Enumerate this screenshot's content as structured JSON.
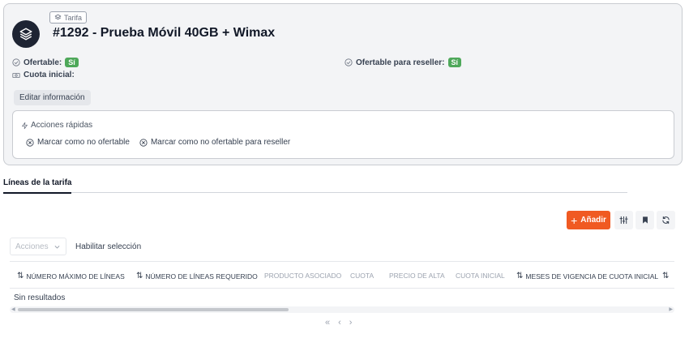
{
  "header": {
    "type_badge": "Tarifa",
    "type_icon": "layers-icon",
    "title": "#1292 - Prueba Móvil 40GB + Wimax"
  },
  "fields": {
    "ofertable_label": "Ofertable:",
    "ofertable_value": "Sí",
    "reseller_label": "Ofertable para reseller:",
    "reseller_value": "Sí",
    "cuota_label": "Cuota inicial:"
  },
  "edit_button": "Editar información",
  "quick_actions": {
    "title": "Acciones rápidas",
    "items": [
      "Marcar como no ofertable",
      "Marcar como no ofertable para reseller"
    ]
  },
  "tabs": [
    {
      "label": "Líneas de la tarifa",
      "active": true
    }
  ],
  "toolbar": {
    "add_label": "Añadir",
    "icons": [
      "columns-adjust-icon",
      "bookmark-icon",
      "refresh-icon"
    ]
  },
  "table_controls": {
    "actions_placeholder": "Acciones",
    "enable_selection": "Habilitar selección"
  },
  "table": {
    "columns": [
      {
        "label": "Número máximo de líneas",
        "sortable": true
      },
      {
        "label": "Número de líneas requerido",
        "sortable": true
      },
      {
        "label": "Producto asociado",
        "sortable": false
      },
      {
        "label": "Cuota",
        "sortable": false
      },
      {
        "label": "Precio de alta",
        "sortable": false
      },
      {
        "label": "Cuota inicial",
        "sortable": false
      },
      {
        "label": "Meses de vigencia de cuota inicial",
        "sortable": true
      },
      {
        "label": "",
        "sortable": true
      }
    ],
    "empty_text": "Sin resultados"
  },
  "colors": {
    "accent": "#f05a22",
    "success": "#4ea85a",
    "logo_bg": "#1e2433"
  }
}
